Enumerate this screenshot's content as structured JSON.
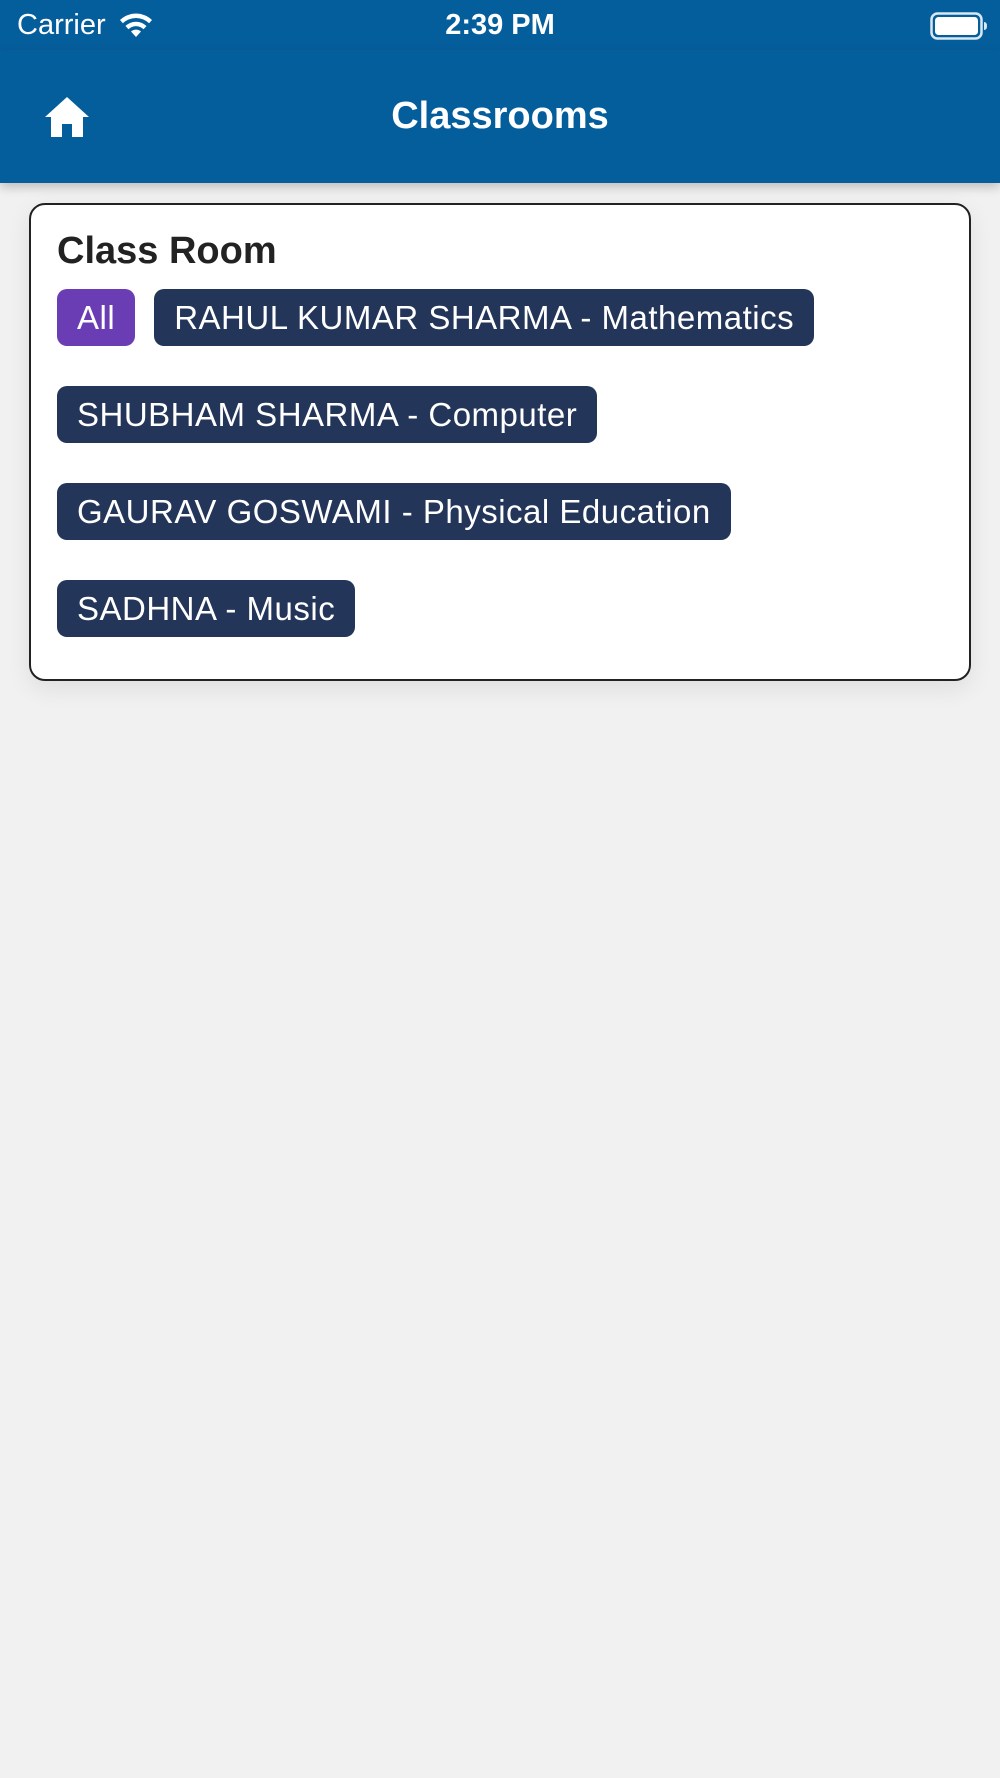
{
  "status_bar": {
    "carrier": "Carrier",
    "time": "2:39 PM",
    "wifi_icon": "wifi-icon",
    "battery_icon": "battery-full-icon"
  },
  "header": {
    "title": "Classrooms",
    "home_icon": "home-icon",
    "background": "#055e9c"
  },
  "card": {
    "title": "Class Room",
    "chips": [
      {
        "label": "All",
        "active": true
      },
      {
        "label": "RAHUL KUMAR SHARMA - Mathematics",
        "active": false
      },
      {
        "label": "SHUBHAM SHARMA - Computer",
        "active": false
      },
      {
        "label": "GAURAV GOSWAMI - Physical Education",
        "active": false
      },
      {
        "label": "SADHNA - Music",
        "active": false
      }
    ],
    "active_chip_color": "#6b3db5",
    "chip_color": "#24355a"
  }
}
